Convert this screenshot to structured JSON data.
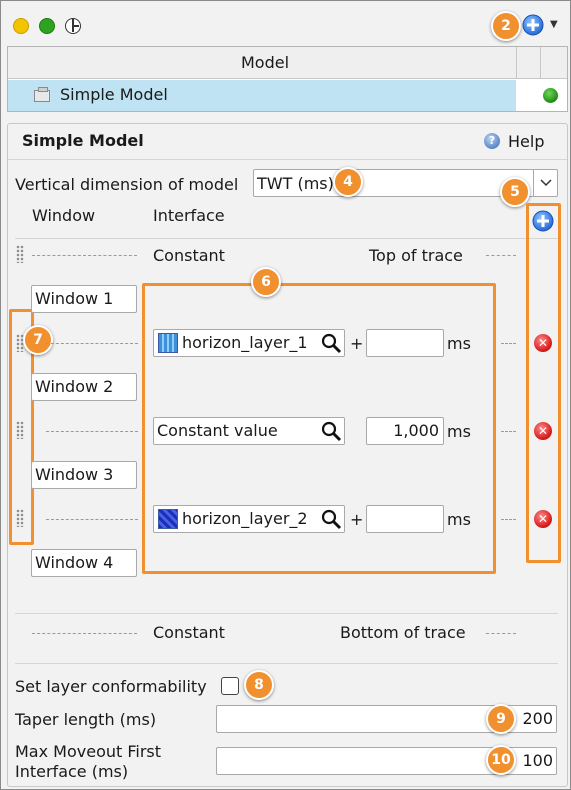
{
  "window": {
    "traffic_lights": [
      "#f5c400",
      "#2ea31f",
      "#ffffff"
    ],
    "add_icon": "plus-circle-icon"
  },
  "table": {
    "header": "Model",
    "rows": [
      {
        "label": "Simple Model",
        "status_color": "#2c9a1c"
      }
    ]
  },
  "panel": {
    "title": "Simple Model",
    "help_label": "Help"
  },
  "vertical": {
    "label": "Vertical dimension of model",
    "value": "TWT (ms)"
  },
  "columns": {
    "window": "Window",
    "interface": "Interface"
  },
  "top": {
    "constant": "Constant",
    "trace": "Top of trace"
  },
  "windows": [
    "Window 1",
    "Window 2",
    "Window 3",
    "Window 4"
  ],
  "interfaces": [
    {
      "name": "horizon_layer_1",
      "plus": "+",
      "value": "",
      "unit": "ms"
    },
    {
      "name": "Constant value",
      "plus": "",
      "value": "1,000",
      "unit": "ms"
    },
    {
      "name": "horizon_layer_2",
      "plus": "+",
      "value": "",
      "unit": "ms"
    }
  ],
  "bottom": {
    "constant": "Constant",
    "trace": "Bottom of trace"
  },
  "conformability": {
    "label": "Set layer conformability",
    "checked": false
  },
  "taper": {
    "label": "Taper length (ms)",
    "value": "200"
  },
  "moveout": {
    "label_line1": "Max Moveout First",
    "label_line2": "Interface (ms)",
    "value": "100"
  },
  "callouts": [
    "2",
    "4",
    "5",
    "6",
    "7",
    "8",
    "9",
    "10"
  ]
}
